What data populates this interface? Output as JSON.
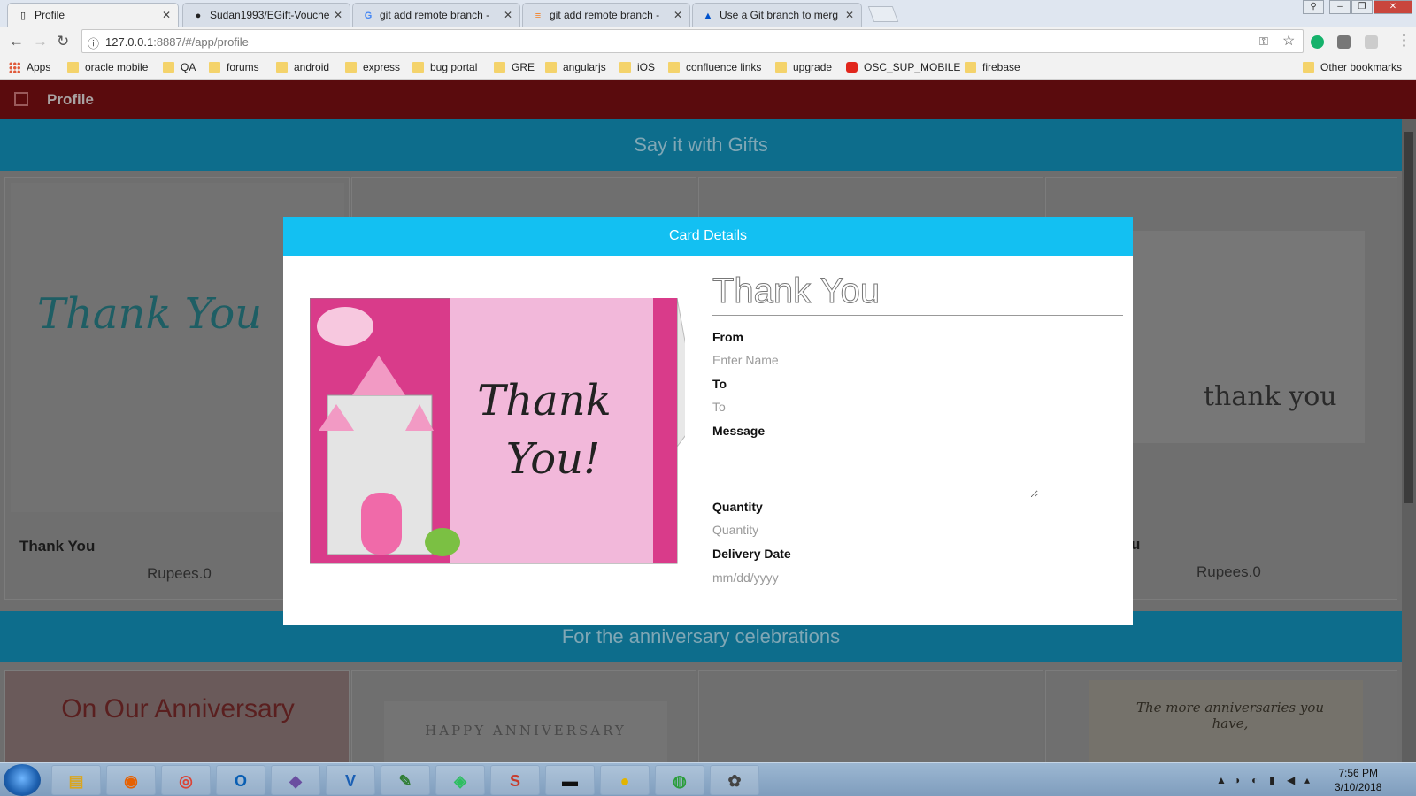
{
  "browser": {
    "tabs": [
      {
        "title": "Profile",
        "icon": "page-icon",
        "active": true
      },
      {
        "title": "Sudan1993/EGift-Vouche",
        "icon": "github-icon",
        "active": false
      },
      {
        "title": "git add remote branch -",
        "icon": "google-icon",
        "active": false
      },
      {
        "title": "git add remote branch -",
        "icon": "stackoverflow-icon",
        "active": false
      },
      {
        "title": "Use a Git branch to merg",
        "icon": "atlassian-icon",
        "active": false
      }
    ],
    "url_host": "127.0.0.1",
    "url_rest": ":8887/#/app/profile",
    "bookmarks": [
      {
        "label": "Apps",
        "icon": "apps-icon"
      },
      {
        "label": "oracle mobile",
        "icon": "folder-icon"
      },
      {
        "label": "QA",
        "icon": "folder-icon"
      },
      {
        "label": "forums",
        "icon": "folder-icon"
      },
      {
        "label": "android",
        "icon": "folder-icon"
      },
      {
        "label": "express",
        "icon": "folder-icon"
      },
      {
        "label": "bug portal",
        "icon": "folder-icon"
      },
      {
        "label": "GRE",
        "icon": "folder-icon"
      },
      {
        "label": "angularjs",
        "icon": "folder-icon"
      },
      {
        "label": "iOS",
        "icon": "folder-icon"
      },
      {
        "label": "confluence links",
        "icon": "folder-icon"
      },
      {
        "label": "upgrade",
        "icon": "folder-icon"
      },
      {
        "label": "OSC_SUP_MOBILE",
        "icon": "oracle-icon"
      },
      {
        "label": "firebase",
        "icon": "folder-icon"
      }
    ],
    "other_bookmarks": "Other bookmarks"
  },
  "app": {
    "title": "Profile",
    "sections": [
      {
        "heading": "Say it with Gifts"
      },
      {
        "heading": "For the anniversary celebrations"
      }
    ],
    "cards_row1": [
      {
        "name": "Thank You",
        "price": "Rupees.0",
        "art_text": "Thank You"
      },
      {
        "name": "u",
        "price": "Rupees.0",
        "art_text": "thank you"
      }
    ],
    "cards_row2": [
      {
        "art_text": "On Our Anniversary"
      },
      {
        "art_text": "HAPPY ANNIVERSARY"
      },
      {
        "art_text": ""
      },
      {
        "art_text": "The more anniversaries you have,"
      }
    ]
  },
  "modal": {
    "header": "Card Details",
    "card_title": "Thank You",
    "card_art_line1": "Thank",
    "card_art_line2": "You!",
    "from_label": "From",
    "from_placeholder": "Enter Name",
    "to_label": "To",
    "to_placeholder": "To",
    "message_label": "Message",
    "quantity_label": "Quantity",
    "quantity_placeholder": "Quantity",
    "delivery_label": "Delivery Date",
    "delivery_placeholder": "mm/dd/yyyy"
  },
  "taskbar": {
    "apps": [
      "explorer-icon",
      "firefox-icon",
      "chrome-icon",
      "outlook-icon",
      "pidgin-icon",
      "vc-icon",
      "notepad-icon",
      "evernote-icon",
      "sublime-icon",
      "cmd-icon",
      "status-icon",
      "globe-icon",
      "paint-icon"
    ],
    "time": "7:56 PM",
    "date": "3/10/2018"
  },
  "colors": {
    "appbar": "#5a0b0d",
    "section_band": "#0d6d8c",
    "modal_header": "#13c0f2"
  }
}
